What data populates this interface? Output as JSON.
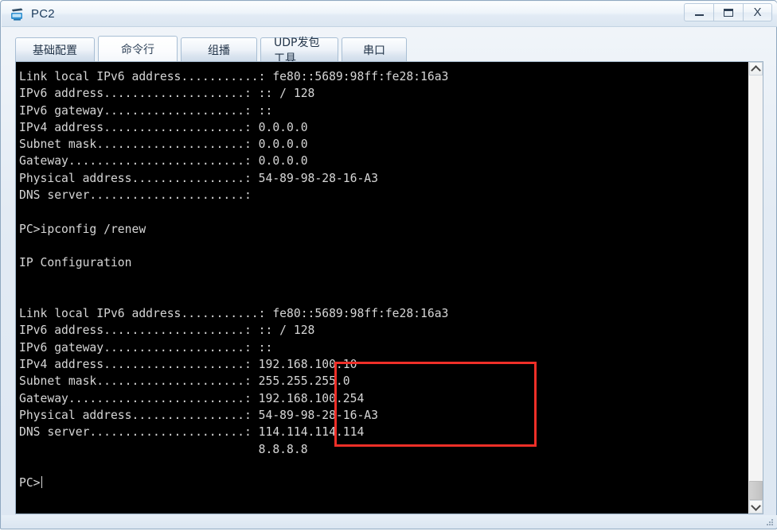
{
  "window": {
    "title": "PC2",
    "icon": "pc-device-icon",
    "controls": {
      "minimize": "minimize-icon",
      "maximize": "maximize-icon",
      "close": "X"
    }
  },
  "tabs": [
    {
      "label": "基础配置",
      "active": false
    },
    {
      "label": "命令行",
      "active": true
    },
    {
      "label": "组播",
      "active": false
    },
    {
      "label": "UDP发包工具",
      "active": false
    },
    {
      "label": "串口",
      "active": false
    }
  ],
  "terminal": {
    "prompt": "PC>",
    "lines": [
      "Link local IPv6 address...........: fe80::5689:98ff:fe28:16a3",
      "IPv6 address....................: :: / 128",
      "IPv6 gateway....................: ::",
      "IPv4 address....................: 0.0.0.0",
      "Subnet mask.....................: 0.0.0.0",
      "Gateway.........................: 0.0.0.0",
      "Physical address................: 54-89-98-28-16-A3",
      "DNS server......................:",
      "",
      "PC>ipconfig /renew",
      "",
      "IP Configuration",
      "",
      "",
      "Link local IPv6 address...........: fe80::5689:98ff:fe28:16a3",
      "IPv6 address....................: :: / 128",
      "IPv6 gateway....................: ::",
      "IPv4 address....................: 192.168.100.10",
      "Subnet mask.....................: 255.255.255.0",
      "Gateway.........................: 192.168.100.254",
      "Physical address................: 54-89-98-28-16-A3",
      "DNS server......................: 114.114.114.114",
      "                                  8.8.8.8",
      "",
      "PC>"
    ],
    "command_entered": "ipconfig /renew",
    "result_heading": "IP Configuration",
    "initial_config": {
      "link_local_ipv6_address": "fe80::5689:98ff:fe28:16a3",
      "ipv6_address": ":: / 128",
      "ipv6_gateway": "::",
      "ipv4_address": "0.0.0.0",
      "subnet_mask": "0.0.0.0",
      "gateway": "0.0.0.0",
      "physical_address": "54-89-98-28-16-A3",
      "dns_server": ""
    },
    "renewed_config": {
      "link_local_ipv6_address": "fe80::5689:98ff:fe28:16a3",
      "ipv6_address": ":: / 128",
      "ipv6_gateway": "::",
      "ipv4_address": "192.168.100.10",
      "subnet_mask": "255.255.255.0",
      "gateway": "192.168.100.254",
      "physical_address": "54-89-98-28-16-A3",
      "dns_server_primary": "114.114.114.114",
      "dns_server_secondary": "8.8.8.8"
    }
  },
  "annotation": {
    "type": "rectangle-highlight",
    "color": "#ef2f28",
    "covers": [
      "192.168.100.10",
      "255.255.255.0",
      "192.168.100.254",
      "54-89-98-28-16-A3",
      "114.114.114.114"
    ]
  },
  "scrollbar": {
    "up_arrow": "chevron-up-icon",
    "down_arrow": "chevron-down-icon",
    "position": "bottom"
  },
  "colors": {
    "terminal_background": "#000000",
    "terminal_text": "#d6d6d6",
    "highlight": "#ef2f28",
    "title_text": "#1a3a5c"
  }
}
